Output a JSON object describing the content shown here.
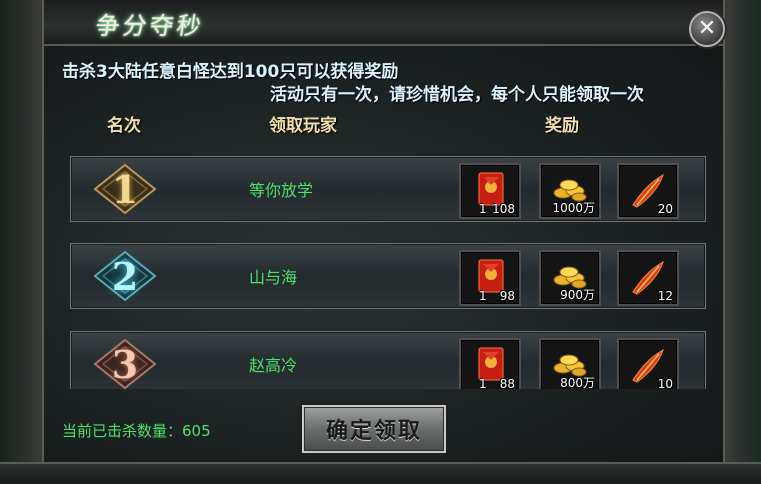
{
  "window": {
    "title": "争分夺秒"
  },
  "notice": {
    "line1": "击杀3大陆任意白怪达到100只可以获得奖励",
    "line2": "活动只有一次，请珍惜机会，每个人只能领取一次"
  },
  "columns": {
    "rank": "名次",
    "player": "领取玩家",
    "reward": "奖励"
  },
  "rows": [
    {
      "rank": "1",
      "player": "等你放学",
      "rewards": [
        {
          "icon": "red-envelope-icon",
          "count": "108",
          "prefix": "1"
        },
        {
          "icon": "gold-coins-icon",
          "count": "1000万"
        },
        {
          "icon": "red-feather-icon",
          "count": "20"
        }
      ]
    },
    {
      "rank": "2",
      "player": "山与海",
      "rewards": [
        {
          "icon": "red-envelope-icon",
          "count": "98",
          "prefix": "1"
        },
        {
          "icon": "gold-coins-icon",
          "count": "900万"
        },
        {
          "icon": "red-feather-icon",
          "count": "12"
        }
      ]
    },
    {
      "rank": "3",
      "player": "赵高冷",
      "rewards": [
        {
          "icon": "red-envelope-icon",
          "count": "88",
          "prefix": "1"
        },
        {
          "icon": "gold-coins-icon",
          "count": "800万"
        },
        {
          "icon": "red-feather-icon",
          "count": "10"
        }
      ]
    }
  ],
  "footer": {
    "kill_count": "当前已击杀数量：605",
    "confirm_label": "确定领取"
  },
  "colors": {
    "rank1": "#e8c878",
    "rank2": "#7fe0f0",
    "rank3": "#e8a98a",
    "player": "#4ee26b",
    "notice": "#d9f4ff",
    "header": "#f0dfad"
  }
}
